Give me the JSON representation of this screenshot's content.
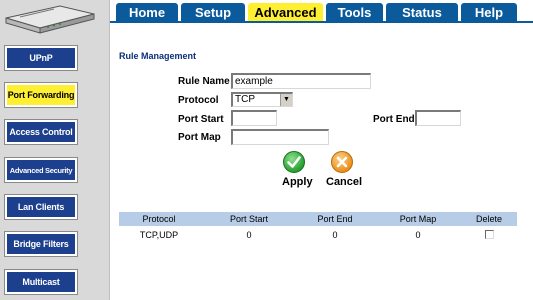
{
  "top_nav": {
    "tabs": [
      "Home",
      "Setup",
      "Advanced",
      "Tools",
      "Status",
      "Help"
    ],
    "active_tab": "Advanced"
  },
  "sidebar": {
    "items": [
      "UPnP",
      "Port Forwarding",
      "Access Control",
      "Advanced Security",
      "Lan Clients",
      "Bridge Filters",
      "Multicast"
    ],
    "active_item": "Port Forwarding"
  },
  "section": {
    "title": "Rule Management"
  },
  "form": {
    "rule_name_label": "Rule Name",
    "rule_name_value": "example",
    "protocol_label": "Protocol",
    "protocol_value": "TCP",
    "port_start_label": "Port Start",
    "port_start_value": "",
    "port_end_label": "Port End",
    "port_end_value": "",
    "port_map_label": "Port Map",
    "port_map_value": ""
  },
  "actions": {
    "apply_label": "Apply",
    "cancel_label": "Cancel"
  },
  "table": {
    "headers": [
      "Protocol",
      "Port Start",
      "Port End",
      "Port Map",
      "Delete"
    ],
    "rows": [
      {
        "protocol": "TCP,UDP",
        "port_start": "0",
        "port_end": "0",
        "port_map": "0",
        "delete_checked": false
      }
    ]
  },
  "colors": {
    "nav_blue": "#0b5a9b",
    "sidebar_button_blue": "#1c3f8e",
    "active_yellow": "#ffef33",
    "table_header": "#b7cce6",
    "apply_green": "#1f9a2c",
    "cancel_orange": "#e98a14"
  },
  "icons": {
    "apply": "checkmark-icon",
    "cancel": "x-icon",
    "router": "router-device-icon"
  }
}
